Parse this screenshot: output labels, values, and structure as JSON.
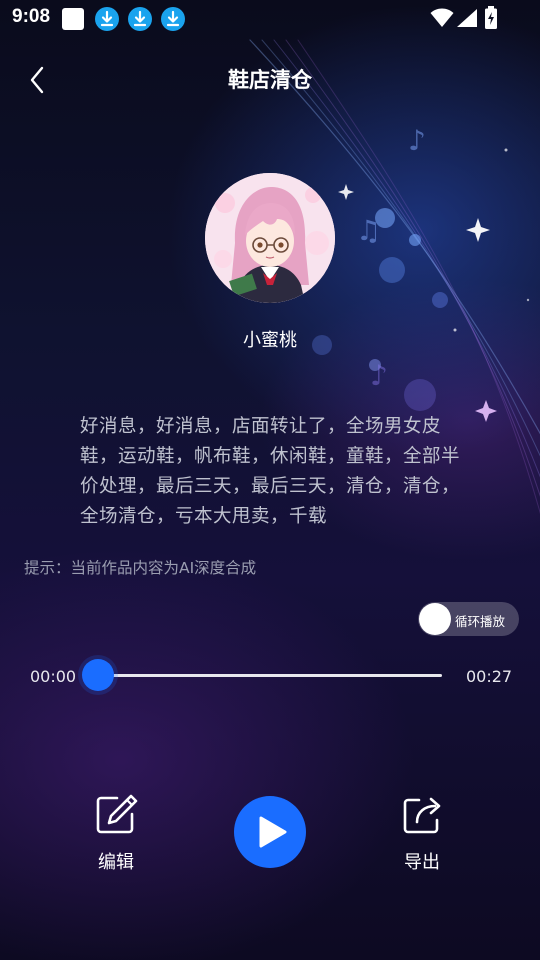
{
  "status_bar": {
    "time": "9:08"
  },
  "header": {
    "title": "鞋店清仓"
  },
  "author": {
    "name": "小蜜桃"
  },
  "lyrics": {
    "text": "好消息，好消息，店面转让了，全场男女皮鞋，运动鞋，帆布鞋，休闲鞋，童鞋，全部半价处理，最后三天，最后三天，清仓，清仓，全场清仓，亏本大甩卖，千载"
  },
  "tip": {
    "text": "提示：当前作品内容为AI深度合成"
  },
  "loop_toggle": {
    "label": "循环播放",
    "on": false
  },
  "player": {
    "current_time": "00:00",
    "total_time": "00:27",
    "progress": 0.0
  },
  "controls": {
    "edit_label": "编辑",
    "export_label": "导出"
  },
  "colors": {
    "accent": "#1a6dff",
    "download_badge": "#1aa3ee"
  }
}
